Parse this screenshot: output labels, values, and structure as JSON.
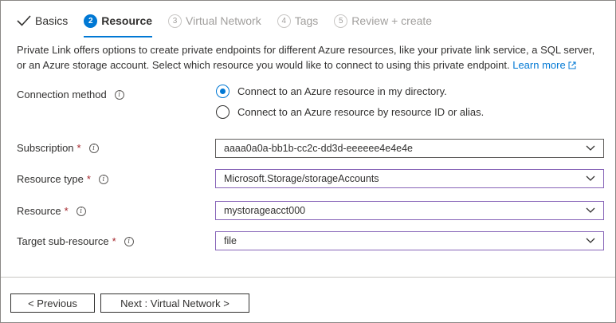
{
  "tabs": [
    {
      "num": "",
      "label": "Basics",
      "state": "done"
    },
    {
      "num": "2",
      "label": "Resource",
      "state": "active"
    },
    {
      "num": "3",
      "label": "Virtual Network",
      "state": "disabled"
    },
    {
      "num": "4",
      "label": "Tags",
      "state": "disabled"
    },
    {
      "num": "5",
      "label": "Review + create",
      "state": "disabled"
    }
  ],
  "description": {
    "text": "Private Link offers options to create private endpoints for different Azure resources, like your private link service, a SQL server, or an Azure storage account. Select which resource you would like to connect to using this private endpoint.",
    "link": "Learn more"
  },
  "form": {
    "connection_method": {
      "label": "Connection method",
      "options": [
        {
          "label": "Connect to an Azure resource in my directory.",
          "checked": true
        },
        {
          "label": "Connect to an Azure resource by resource ID or alias.",
          "checked": false
        }
      ]
    },
    "subscription": {
      "label": "Subscription",
      "required_mark": "*",
      "value": "aaaa0a0a-bb1b-cc2c-dd3d-eeeeee4e4e4e"
    },
    "resource_type": {
      "label": "Resource type",
      "required_mark": "*",
      "value": "Microsoft.Storage/storageAccounts"
    },
    "resource": {
      "label": "Resource",
      "required_mark": "*",
      "value": "mystorageacct000"
    },
    "target_sub_resource": {
      "label": "Target sub-resource",
      "required_mark": "*",
      "value": "file"
    }
  },
  "info_glyph": "i",
  "footer": {
    "previous_label": "< Previous",
    "next_label": "Next : Virtual Network >"
  },
  "colors": {
    "accent": "#0078d4",
    "required": "#a4262c",
    "focused_border": "#8764b8"
  }
}
